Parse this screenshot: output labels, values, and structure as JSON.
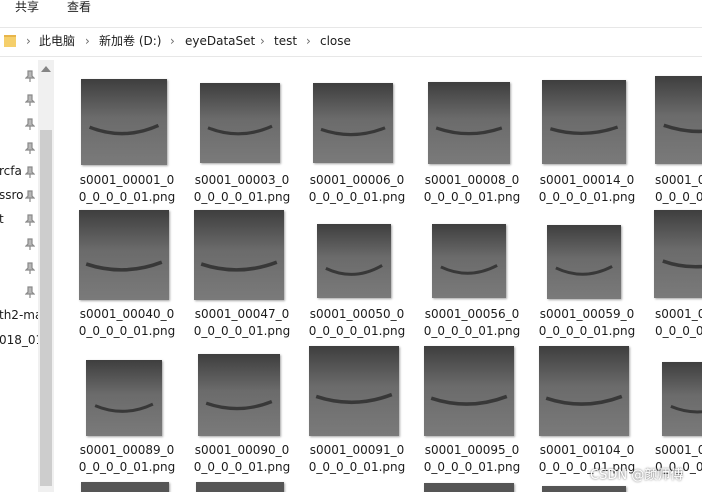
{
  "ribbon": {
    "tabs": [
      "共享",
      "查看"
    ]
  },
  "address_bar": {
    "icon": "folder-icon",
    "breadcrumb": [
      "此电脑",
      "新加卷 (D:)",
      "eyeDataSet",
      "test",
      "close"
    ]
  },
  "nav_pane": {
    "items": [
      "rcfa",
      "ssro",
      "t",
      "th2-ma",
      "018_01"
    ],
    "pin_icon": "pin-icon"
  },
  "files": {
    "row1": [
      {
        "line1": "s0001_00001_0",
        "line2": "0_0_0_0_01.png"
      },
      {
        "line1": "s0001_00003_0",
        "line2": "0_0_0_0_01.png"
      },
      {
        "line1": "s0001_00006_0",
        "line2": "0_0_0_0_01.png"
      },
      {
        "line1": "s0001_00008_0",
        "line2": "0_0_0_0_01.png"
      },
      {
        "line1": "s0001_00014_0",
        "line2": "0_0_0_0_01.png"
      },
      {
        "line1": "s0001_00",
        "line2": "0_0_0_0"
      }
    ],
    "row2": [
      {
        "line1": "s0001_00040_0",
        "line2": "0_0_0_0_01.png"
      },
      {
        "line1": "s0001_00047_0",
        "line2": "0_0_0_0_01.png"
      },
      {
        "line1": "s0001_00050_0",
        "line2": "0_0_0_0_01.png"
      },
      {
        "line1": "s0001_00056_0",
        "line2": "0_0_0_0_01.png"
      },
      {
        "line1": "s0001_00059_0",
        "line2": "0_0_0_0_01.png"
      },
      {
        "line1": "s0001_00",
        "line2": "0_0_0_0"
      }
    ],
    "row3": [
      {
        "line1": "s0001_00089_0",
        "line2": "0_0_0_0_01.png"
      },
      {
        "line1": "s0001_00090_0",
        "line2": "0_0_0_0_01.png"
      },
      {
        "line1": "s0001_00091_0",
        "line2": "0_0_0_0_01.png"
      },
      {
        "line1": "s0001_00095_0",
        "line2": "0_0_0_0_01.png"
      },
      {
        "line1": "s0001_00104_0",
        "line2": "0_0_0_0_01.png"
      },
      {
        "line1": "s0001_00",
        "line2": "0_0_0_0"
      }
    ]
  },
  "watermark": "CSDN @颜师傅",
  "colors": {
    "thumb_dark": "#3e3e3e",
    "thumb_light": "#7a7a7a",
    "crease": "#2a2a2a",
    "scroll_track": "#f0f0f0",
    "scroll_thumb": "#cdcdcd"
  }
}
